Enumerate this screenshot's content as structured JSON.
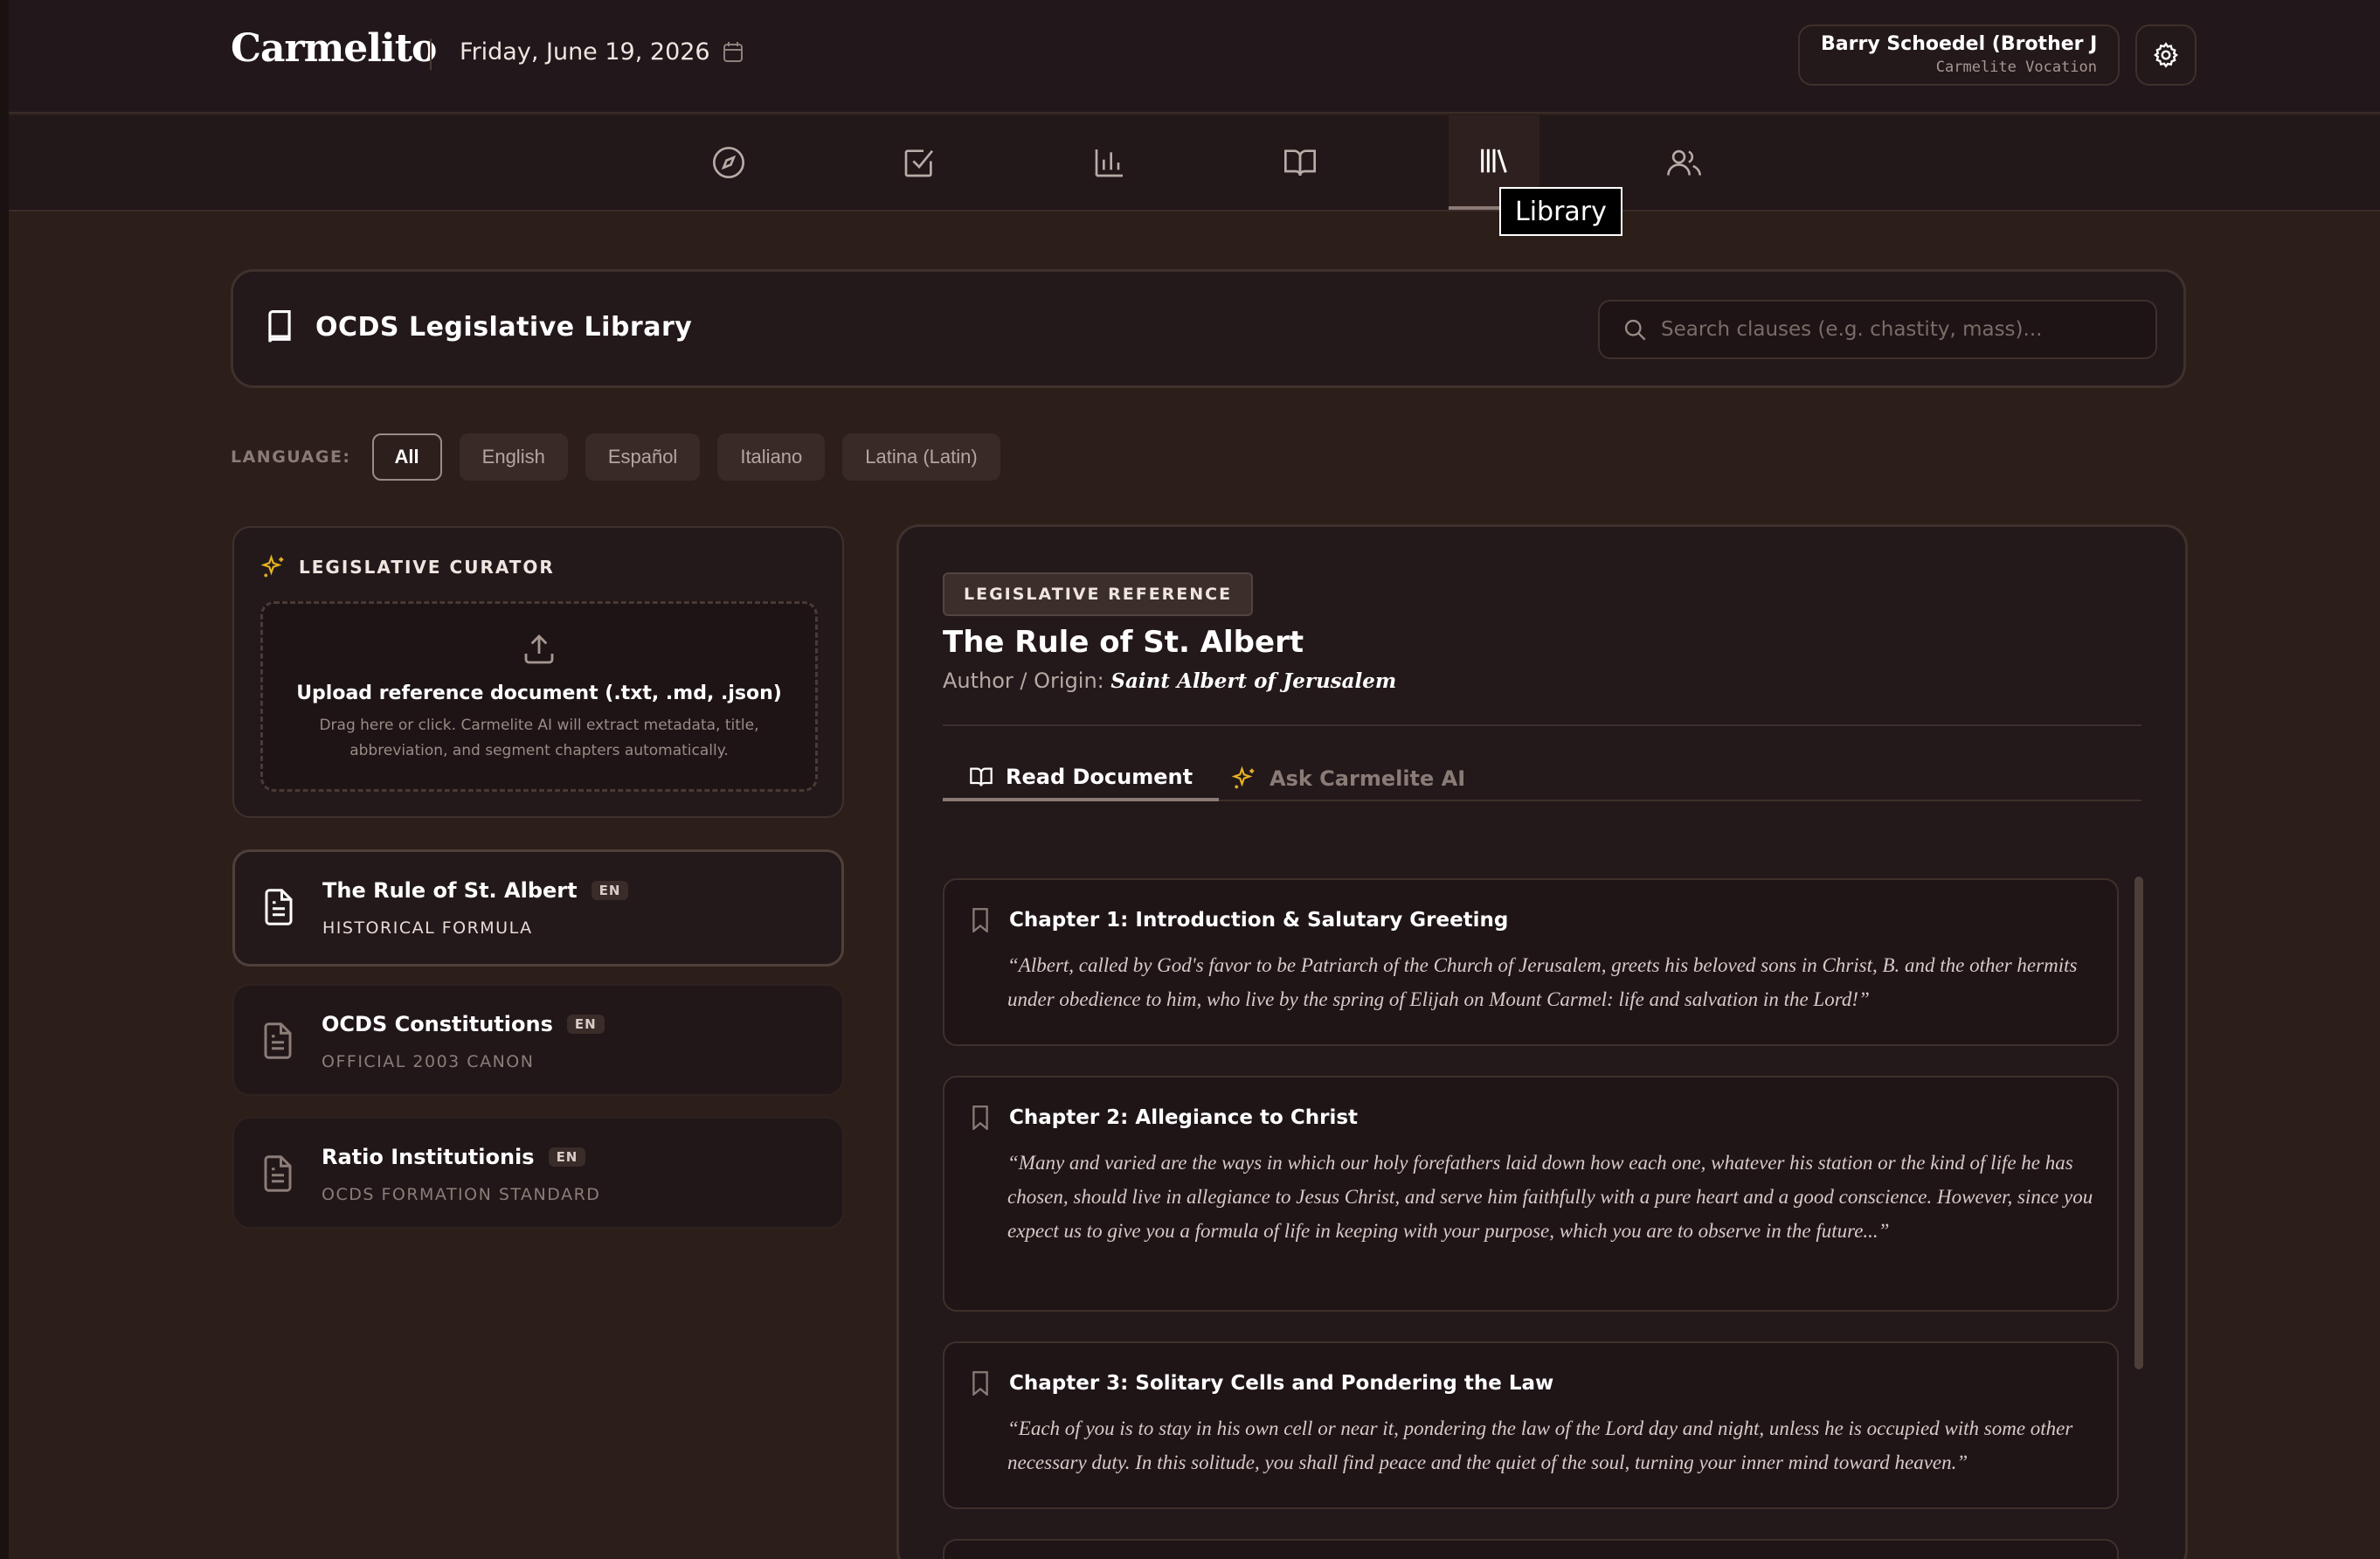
{
  "app": {
    "brand": "Carmelito",
    "date": "Friday, June 19, 2026",
    "user_name": "Barry Schoedel (Brother Jo...",
    "user_role": "Carmelite Vocation"
  },
  "nav": {
    "items": [
      {
        "icon": "compass-icon"
      },
      {
        "icon": "checkbox-icon"
      },
      {
        "icon": "bar-chart-icon"
      },
      {
        "icon": "open-book-icon"
      },
      {
        "icon": "library-icon",
        "active": true
      },
      {
        "icon": "users-icon"
      }
    ],
    "tooltip": "Library"
  },
  "library": {
    "title": "OCDS Legislative Library",
    "search_placeholder": "Search clauses (e.g. chastity, mass)..."
  },
  "language": {
    "label": "LANGUAGE:",
    "options": [
      "All",
      "English",
      "Español",
      "Italiano",
      "Latina (Latin)"
    ],
    "selected": "All"
  },
  "curator": {
    "title": "LEGISLATIVE CURATOR",
    "upload_title": "Upload reference document (.txt, .md, .json)",
    "upload_sub": "Drag here or click. Carmelite AI will extract metadata, title, abbreviation, and segment chapters automatically."
  },
  "documents": [
    {
      "name": "The Rule of St. Albert",
      "lang": "EN",
      "sub": "HISTORICAL FORMULA",
      "active": true
    },
    {
      "name": "OCDS Constitutions",
      "lang": "EN",
      "sub": "OFFICIAL 2003 CANON"
    },
    {
      "name": "Ratio Institutionis",
      "lang": "EN",
      "sub": "OCDS FORMATION STANDARD"
    }
  ],
  "reference": {
    "badge": "LEGISLATIVE REFERENCE",
    "title": "The Rule of St. Albert",
    "author_label": "Author / Origin:",
    "author": "Saint Albert of Jerusalem",
    "tab_read": "Read Document",
    "tab_ai": "Ask Carmelite AI",
    "chapters": [
      {
        "title": "Chapter 1: Introduction & Salutary Greeting",
        "text": "“Albert, called by God's favor to be Patriarch of the Church of Jerusalem, greets his beloved sons in Christ, B. and the other hermits under obedience to him, who live by the spring of Elijah on Mount Carmel: life and salvation in the Lord!”"
      },
      {
        "title": "Chapter 2: Allegiance to Christ",
        "text": "“Many and varied are the ways in which our holy forefathers laid down how each one, whatever his station or the kind of life he has chosen, should live in allegiance to Jesus Christ, and serve him faithfully with a pure heart and a good conscience. However, since you expect us to give you a formula of life in keeping with your purpose, which you are to observe in the future...”"
      },
      {
        "title": "Chapter 3: Solitary Cells and Pondering the Law",
        "text": "“Each of you is to stay in his own cell or near it, pondering the law of the Lord day and night, unless he is occupied with some other necessary duty. In this solitude, you shall find peace and the quiet of the soul, turning your inner mind toward heaven.”"
      }
    ]
  },
  "colors": {
    "background": "#2c1e19",
    "panel": "#23181a",
    "accent_gold": "#e6b422"
  }
}
